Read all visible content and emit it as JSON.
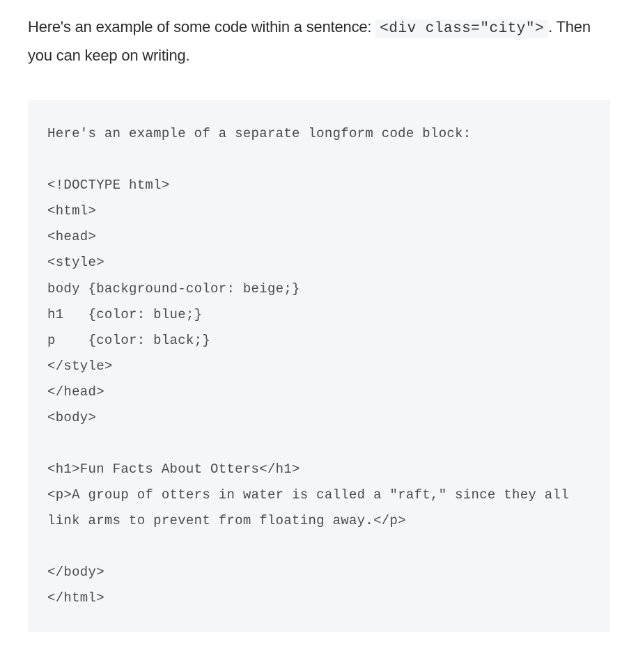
{
  "intro": {
    "text_before": "Here's an example of some code within a sentence: ",
    "inline_code": "<div class=\"city\">",
    "text_after": ". Then you can keep on writing."
  },
  "code_block": {
    "content": "Here's an example of a separate longform code block:\n\n<!DOCTYPE html>\n<html>\n<head>\n<style>\nbody {background-color: beige;}\nh1   {color: blue;}\np    {color: black;}\n</style>\n</head>\n<body>\n\n<h1>Fun Facts About Otters</h1>\n<p>A group of otters in water is called a \"raft,\" since they all link arms to prevent from floating away.</p>\n\n</body>\n</html>"
  }
}
